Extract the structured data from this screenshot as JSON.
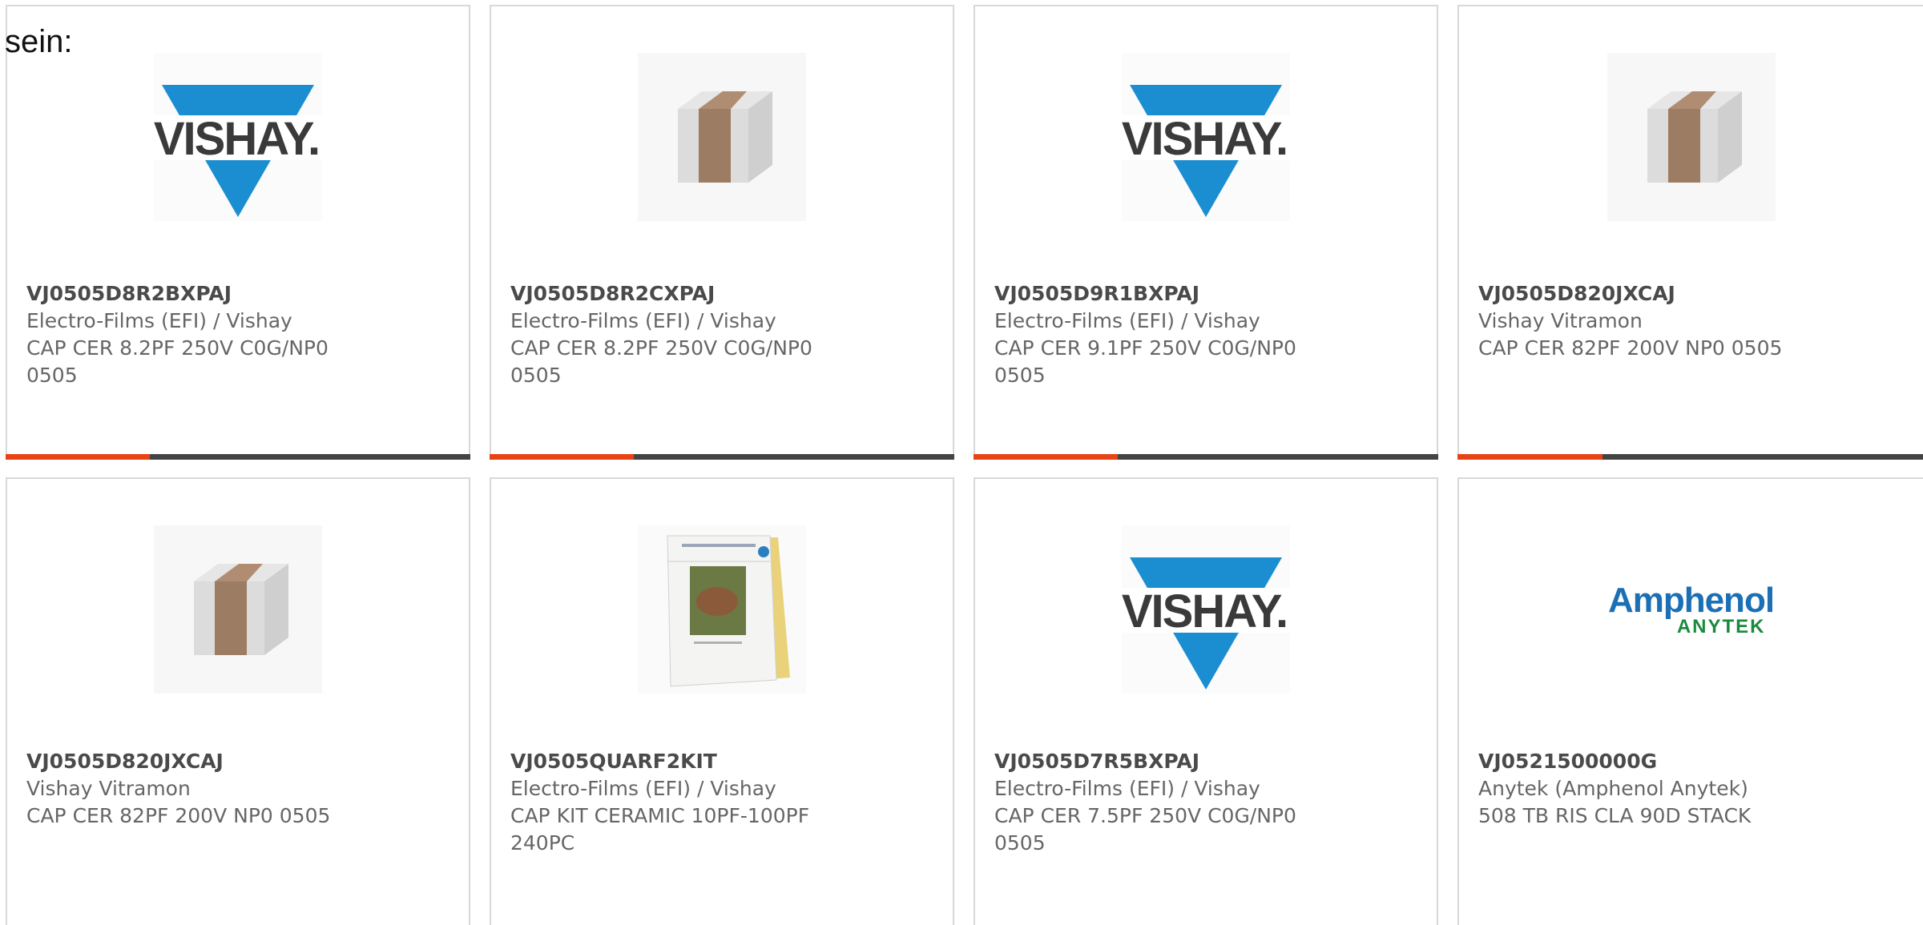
{
  "intro_text": "sein:",
  "colors": {
    "accent": "#e84315",
    "bar_track": "#444444",
    "border": "#d8d8d8",
    "vishay_blue": "#1b8ed1",
    "amphenol_blue": "#1b6fb5",
    "amphenol_green": "#1a8a3c"
  },
  "cards": [
    {
      "image": "vishay-logo",
      "part_number": "VJ0505D8R2BXPAJ",
      "manufacturer": "Electro-Films (EFI) / Vishay",
      "description": "CAP CER 8.2PF 250V C0G/NP0 0505",
      "progress": 0.31
    },
    {
      "image": "ceramic-capacitor",
      "part_number": "VJ0505D8R2CXPAJ",
      "manufacturer": "Electro-Films (EFI) / Vishay",
      "description": "CAP CER 8.2PF 250V C0G/NP0 0505",
      "progress": 0.31
    },
    {
      "image": "vishay-logo",
      "part_number": "VJ0505D9R1BXPAJ",
      "manufacturer": "Electro-Films (EFI) / Vishay",
      "description": "CAP CER 9.1PF 250V C0G/NP0 0505",
      "progress": 0.31
    },
    {
      "image": "ceramic-capacitor",
      "part_number": "VJ0505D820JXCAJ",
      "manufacturer": "Vishay Vitramon",
      "description": "CAP CER 82PF 200V NP0 0505",
      "progress": 0.31
    },
    {
      "image": "ceramic-capacitor",
      "part_number": "VJ0505D820JXCAJ",
      "manufacturer": "Vishay Vitramon",
      "description": "CAP CER 82PF 200V NP0 0505",
      "progress": 0
    },
    {
      "image": "capacitor-kit-booklet",
      "part_number": "VJ0505QUARF2KIT",
      "manufacturer": "Electro-Films (EFI) / Vishay",
      "description": "CAP KIT CERAMIC 10PF-100PF 240PC",
      "progress": 0
    },
    {
      "image": "vishay-logo",
      "part_number": "VJ0505D7R5BXPAJ",
      "manufacturer": "Electro-Films (EFI) / Vishay",
      "description": "CAP CER 7.5PF 250V C0G/NP0 0505",
      "progress": 0
    },
    {
      "image": "amphenol-anytek-logo",
      "part_number": "VJ0521500000G",
      "manufacturer": "Anytek (Amphenol Anytek)",
      "description": "508 TB RIS CLA 90D STACK",
      "progress": 0
    }
  ],
  "logos": {
    "vishay": "VISHAY.",
    "amphenol": "Amphenol",
    "anytek": "ANYTEK"
  }
}
